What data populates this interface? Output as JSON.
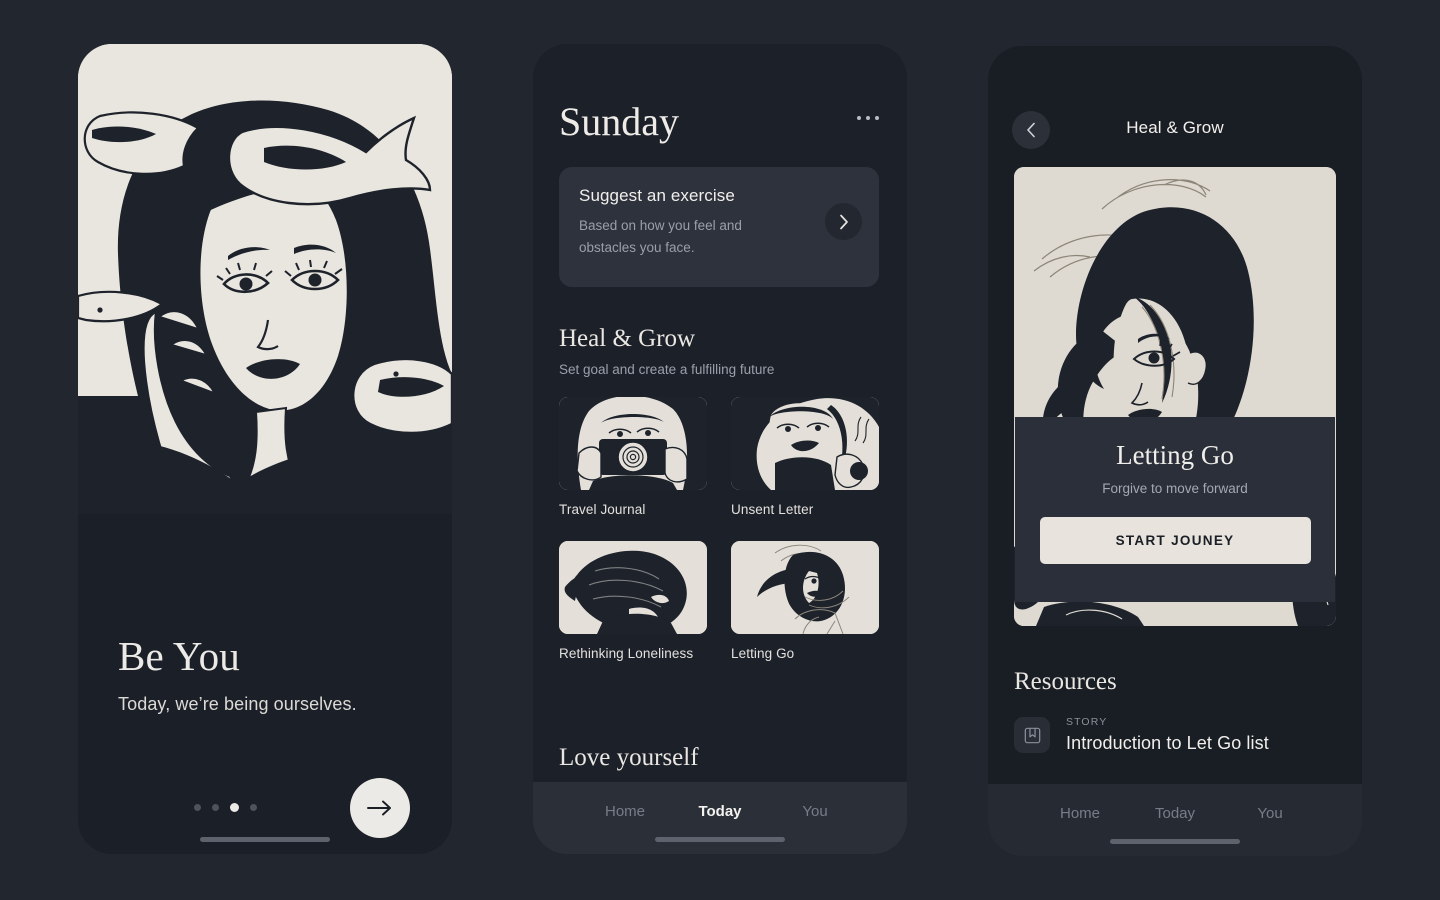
{
  "theme": {
    "page_background": "#22262e",
    "phone_background": "#1b1f27",
    "cream": "#e9e5df",
    "ink": "#1d222b",
    "muted_text": "#9aa0aa",
    "nav_background": "#2a2f38"
  },
  "screen1": {
    "name": "Onboarding",
    "illustration_alt": "woman-resting-head-in-hand-with-koi-fish",
    "title": "Be You",
    "subtitle": "Today, we’re being ourselves.",
    "pagination": {
      "total": 4,
      "active_index": 2
    },
    "next_button_icon": "arrow-right-icon"
  },
  "screen2": {
    "name": "Today",
    "day_title": "Sunday",
    "more_icon": "more-horizontal-icon",
    "suggest_card": {
      "title": "Suggest an exercise",
      "subtitle": "Based on how you feel and obstacles you face.",
      "chevron_icon": "chevron-right-icon"
    },
    "sections": [
      {
        "title": "Heal & Grow",
        "subtitle": "Set goal and create a fulfilling future",
        "tiles": [
          {
            "label": "Travel Journal",
            "art": "camera-girl"
          },
          {
            "label": "Unsent Letter",
            "art": "rose-girl"
          },
          {
            "label": "Rethinking Loneliness",
            "art": "head-down-girl"
          },
          {
            "label": "Letting Go",
            "art": "windblown-girl"
          }
        ]
      },
      {
        "title": "Love yourself",
        "subtitle": "",
        "tiles": []
      }
    ],
    "bottom_nav": {
      "items": [
        {
          "label": "Home",
          "active": false
        },
        {
          "label": "Today",
          "active": true
        },
        {
          "label": "You",
          "active": false
        }
      ]
    }
  },
  "screen3": {
    "name": "Heal & Grow Detail",
    "back_icon": "chevron-left-icon",
    "title": "Heal & Grow",
    "hero_alt": "windblown-hair-girl-portrait",
    "overlay": {
      "title": "Letting Go",
      "subtitle": "Forgive to move forward",
      "cta_label": "START JOUNEY"
    },
    "resources": {
      "title": "Resources",
      "items": [
        {
          "kicker": "STORY",
          "name": "Introduction to Let Go list",
          "icon": "book-bookmark-icon"
        }
      ]
    },
    "bottom_nav": {
      "items": [
        {
          "label": "Home",
          "active": false
        },
        {
          "label": "Today",
          "active": false
        },
        {
          "label": "You",
          "active": false
        }
      ]
    }
  }
}
